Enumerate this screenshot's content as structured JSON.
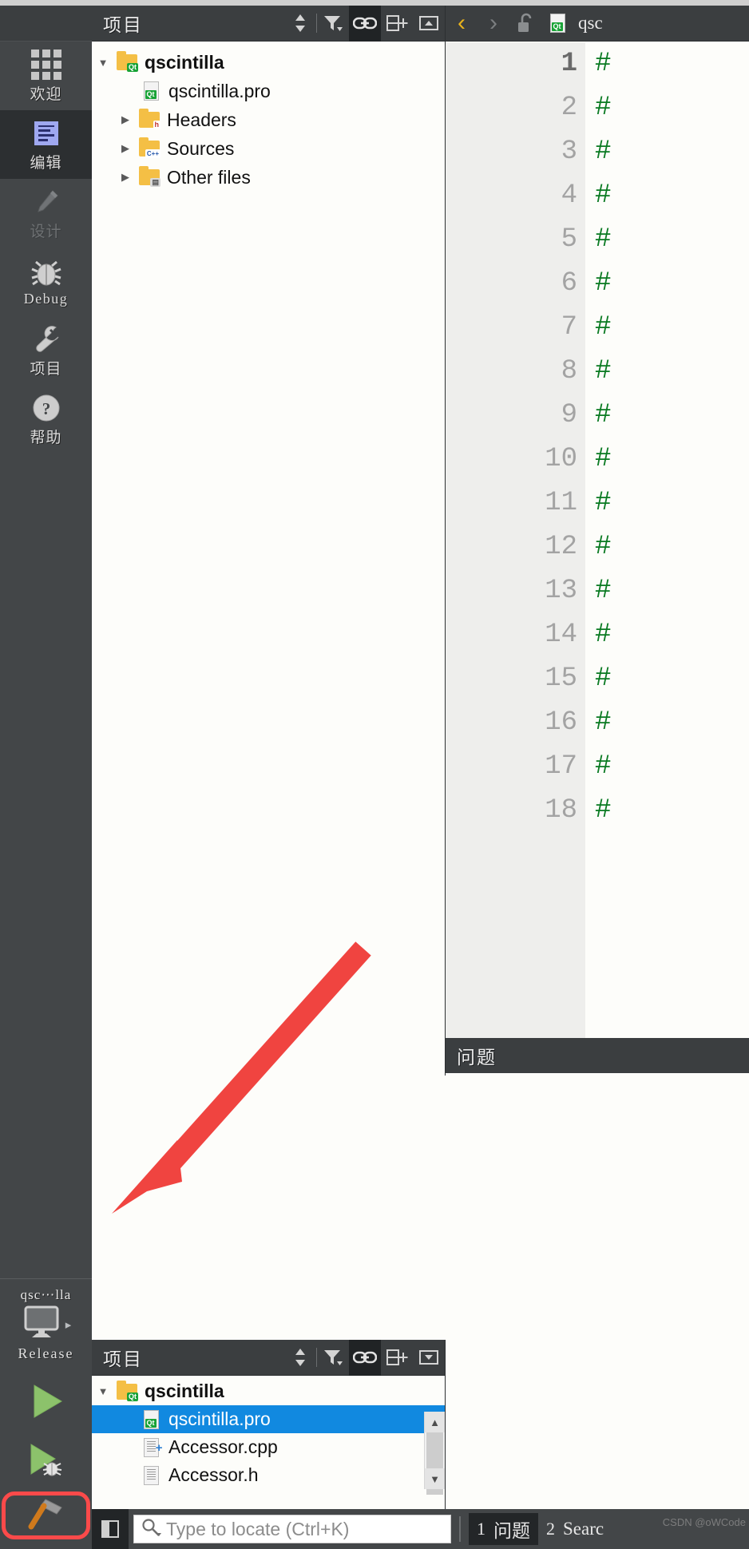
{
  "app": {
    "left_modebar": {
      "items": [
        {
          "label": "欢迎",
          "icon": "grid-icon",
          "state": "normal"
        },
        {
          "label": "编辑",
          "icon": "edit-document-icon",
          "state": "selected"
        },
        {
          "label": "设计",
          "icon": "pencil-icon",
          "state": "disabled"
        },
        {
          "label": "Debug",
          "icon": "bug-icon",
          "state": "normal"
        },
        {
          "label": "项目",
          "icon": "wrench-icon",
          "state": "normal"
        },
        {
          "label": "帮助",
          "icon": "question-mark-icon",
          "state": "normal"
        }
      ],
      "kit": {
        "project_name": "qsc⋯lla",
        "target_icon": "monitor-icon",
        "expand_arrow": "▸",
        "build_config": "Release"
      },
      "run_buttons": [
        {
          "name": "run-button",
          "icon": "green-play-triangle"
        },
        {
          "name": "debug-button",
          "icon": "green-play-with-bug"
        },
        {
          "name": "build-button",
          "icon": "hammer-icon",
          "highlighted": true
        }
      ],
      "highlight_color": "#fb4a4a"
    },
    "project_panel": {
      "title": "项目",
      "toolbar": [
        {
          "name": "sync-selection-toggle",
          "icon": "up-down-arrows-icon",
          "active": false
        },
        {
          "name": "filter-button",
          "icon": "filter-funnel-icon",
          "active": false
        },
        {
          "name": "link-with-editor-toggle",
          "icon": "chain-link-icon",
          "active": true
        },
        {
          "name": "split-add-button",
          "icon": "split-plus-icon",
          "active": false
        },
        {
          "name": "close-split-button",
          "icon": "close-split-icon",
          "active": false
        }
      ],
      "tree": [
        {
          "label": "qscintilla",
          "icon": "folder-qt-icon",
          "arrow": "▼",
          "depth": 0,
          "bold": true,
          "selected": false
        },
        {
          "label": "qscintilla.pro",
          "icon": "file-qt-pro-icon",
          "arrow": "",
          "depth": 1,
          "bold": false,
          "selected": false
        },
        {
          "label": "Headers",
          "icon": "folder-h-icon",
          "arrow": "▶",
          "depth": 1,
          "bold": false,
          "selected": false
        },
        {
          "label": "Sources",
          "icon": "folder-cpp-icon",
          "arrow": "▶",
          "depth": 1,
          "bold": false,
          "selected": false
        },
        {
          "label": "Other files",
          "icon": "folder-other-icon",
          "arrow": "▶",
          "depth": 1,
          "bold": false,
          "selected": false
        }
      ]
    },
    "editor": {
      "nav": {
        "back": "‹",
        "forward": "›",
        "lock_icon": "unlocked-padlock-icon",
        "file_icon": "file-qt-pro-icon",
        "tab_name": "qsc"
      },
      "lines": [
        {
          "n": "1",
          "text": "#"
        },
        {
          "n": "2",
          "text": "#"
        },
        {
          "n": "3",
          "text": "#"
        },
        {
          "n": "4",
          "text": "#"
        },
        {
          "n": "5",
          "text": "#"
        },
        {
          "n": "6",
          "text": "#"
        },
        {
          "n": "7",
          "text": "#"
        },
        {
          "n": "8",
          "text": "#"
        },
        {
          "n": "9",
          "text": "#"
        },
        {
          "n": "10",
          "text": "#"
        },
        {
          "n": "11",
          "text": "#"
        },
        {
          "n": "12",
          "text": "#"
        },
        {
          "n": "13",
          "text": "#"
        },
        {
          "n": "14",
          "text": "#"
        },
        {
          "n": "15",
          "text": "#"
        },
        {
          "n": "16",
          "text": "#"
        },
        {
          "n": "17",
          "text": "#"
        },
        {
          "n": "18",
          "text": "#"
        }
      ],
      "current_line": "1",
      "comment_color": "#0a7a22"
    },
    "issues_panel": {
      "title": "问题"
    },
    "project_panel_bottom": {
      "title": "项目",
      "toolbar": [
        {
          "name": "sync-selection-toggle",
          "icon": "up-down-arrows-icon",
          "active": false
        },
        {
          "name": "filter-button",
          "icon": "filter-funnel-icon",
          "active": false
        },
        {
          "name": "link-with-editor-toggle",
          "icon": "chain-link-icon",
          "active": true
        },
        {
          "name": "split-add-button",
          "icon": "split-plus-icon",
          "active": false
        },
        {
          "name": "close-split-button",
          "icon": "close-split-icon",
          "active": false
        }
      ],
      "tree": [
        {
          "label": "qscintilla",
          "icon": "folder-qt-icon",
          "arrow": "▼",
          "depth": 0,
          "bold": true,
          "selected": false
        },
        {
          "label": "qscintilla.pro",
          "icon": "file-qt-pro-icon",
          "arrow": "",
          "depth": 1,
          "bold": false,
          "selected": true
        },
        {
          "label": "Accessor.cpp",
          "icon": "file-cpp-icon",
          "arrow": "",
          "depth": 1,
          "bold": false,
          "selected": false
        },
        {
          "label": "Accessor.h",
          "icon": "file-h-icon",
          "arrow": "",
          "depth": 1,
          "bold": false,
          "selected": false
        }
      ],
      "scrollbar": {
        "up": "▲",
        "down": "▼"
      },
      "selection_color": "#1189e0"
    },
    "statusbar": {
      "sidebar_toggle_icon": "sidebar-toggle-icon",
      "search_icon": "magnifier-icon",
      "locate_placeholder": "Type to locate (Ctrl+K)",
      "locate_value": "",
      "panes": [
        {
          "num": "1",
          "label": "问题",
          "active": true
        },
        {
          "num": "2",
          "label": "Searc",
          "active": false
        }
      ]
    },
    "watermark": "CSDN @oWCode"
  }
}
